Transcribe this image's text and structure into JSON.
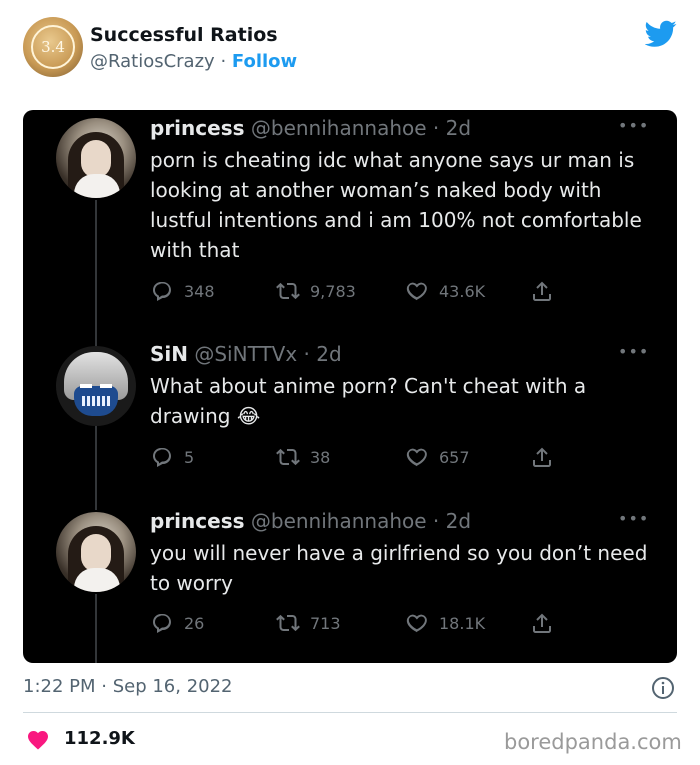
{
  "account": {
    "name": "Successful Ratios",
    "handle": "@RatiosCrazy",
    "separator": "·",
    "follow_label": "Follow",
    "avatar_text": "3.4"
  },
  "tweets": [
    {
      "name": "princess",
      "handle": "@bennihannahoe",
      "time": "· 2d",
      "text": "porn is cheating idc what anyone says ur man is looking at another woman’s naked body with lustful intentions and i am 100% not comfortable with that",
      "replies": "348",
      "retweets": "9,783",
      "likes": "43.6K"
    },
    {
      "name": "SiN",
      "handle": "@SiNTTVx",
      "time": "· 2d",
      "text": "What about anime porn? Can't cheat with a drawing 😂",
      "replies": "5",
      "retweets": "38",
      "likes": "657"
    },
    {
      "name": "princess",
      "handle": "@bennihannahoe",
      "time": "· 2d",
      "text": "you will never have a girlfriend so you don’t need to worry",
      "replies": "26",
      "retweets": "713",
      "likes": "18.1K"
    }
  ],
  "footer": {
    "timestamp": "1:22 PM · Sep 16, 2022",
    "likes": "112.9K",
    "brand": "boredpanda.com"
  },
  "colors": {
    "accent": "#1d9bf0",
    "heart": "#f91880",
    "dark_bg": "#000000"
  },
  "icons": [
    "twitter-bird-icon",
    "more-icon",
    "reply-icon",
    "retweet-icon",
    "like-icon",
    "share-icon",
    "info-icon",
    "heart-icon"
  ]
}
